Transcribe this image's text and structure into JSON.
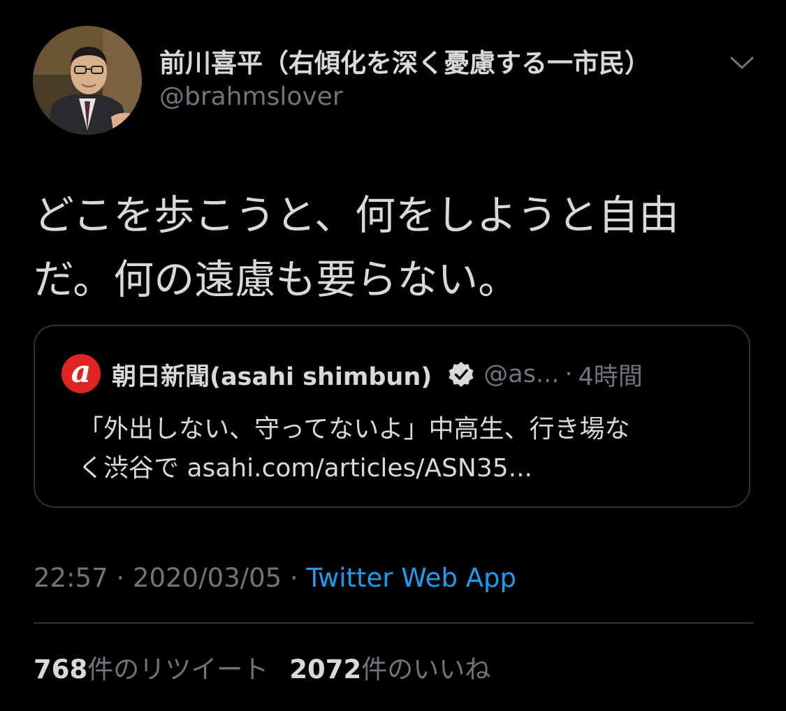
{
  "tweet": {
    "author": {
      "name": "前川喜平（右傾化を深く憂慮する一市民）",
      "handle": "@brahmslover"
    },
    "text_lines": [
      "どこを歩こうと、何をしようと自由",
      "だ。何の遠慮も要らない。"
    ],
    "quoted": {
      "logo_letter": "a",
      "name": "朝日新聞(asahi shimbun)",
      "handle": "@as...",
      "separator": "·",
      "time": "4時間",
      "text_lines": [
        "「外出しない、守ってないよ」中高生、行き場な",
        "く渋谷で asahi.com/articles/ASN35..."
      ]
    },
    "meta": {
      "time": "22:57",
      "date": "2020/03/05",
      "separator": "·",
      "source": "Twitter Web App"
    },
    "stats": {
      "retweet_count": "768",
      "retweet_label": "件のリツイート",
      "like_count": "2072",
      "like_label": "件のいいね"
    }
  },
  "icons": {
    "menu": "chevron-down-icon",
    "verified": "verified-badge-icon"
  },
  "colors": {
    "background": "#000000",
    "text": "#d9d9d9",
    "muted": "#6e767d",
    "link": "#1d9bf0",
    "border": "#2f3336",
    "asahi_red": "#e02424"
  }
}
